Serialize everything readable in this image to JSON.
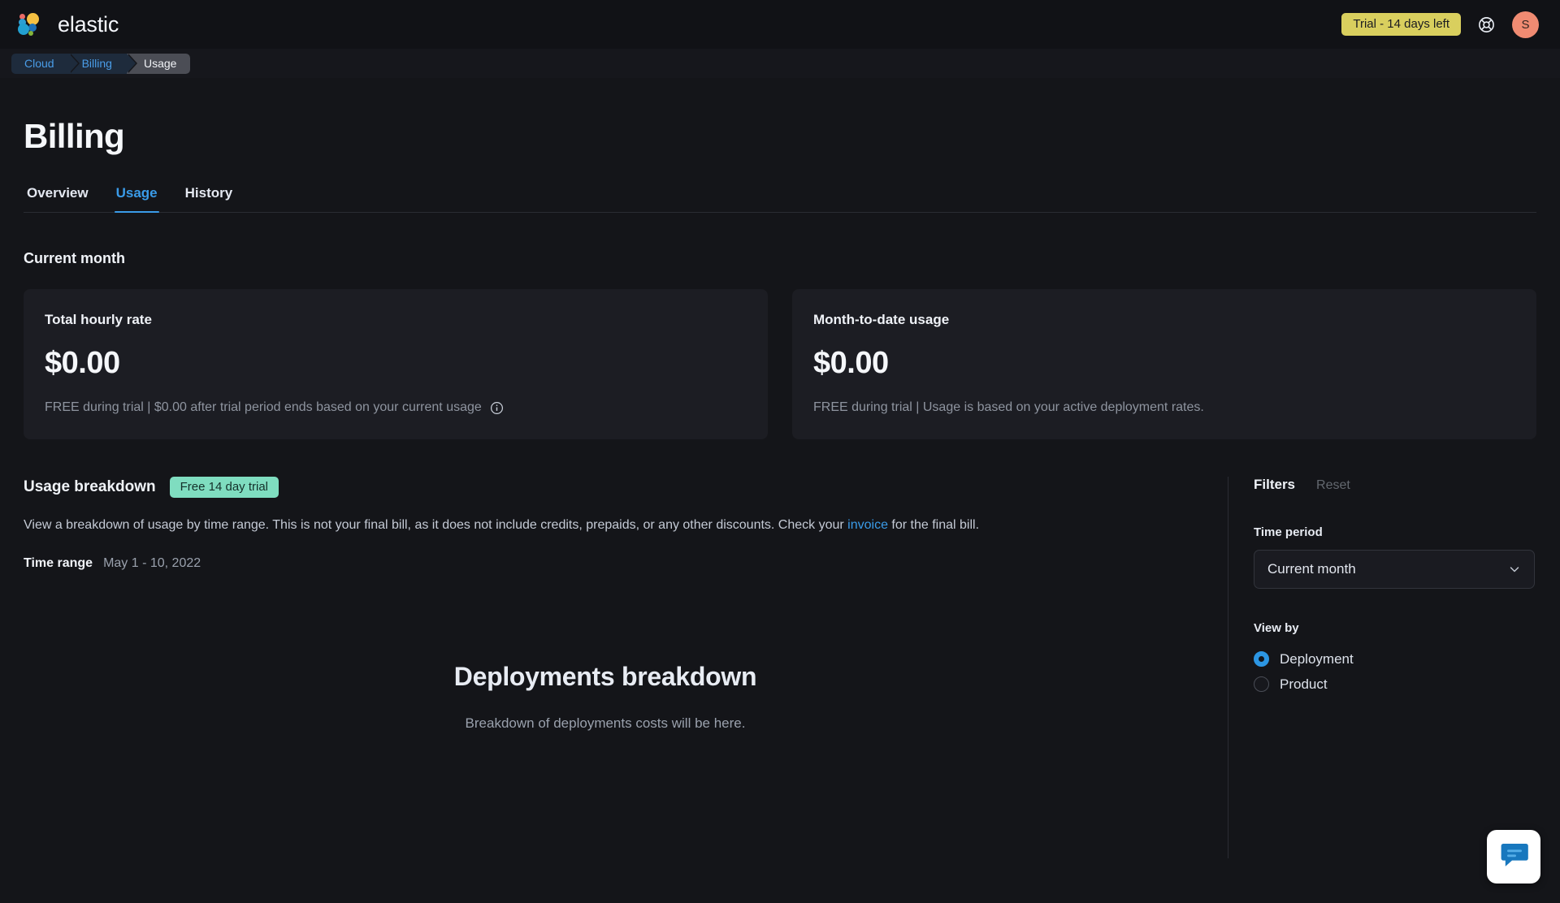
{
  "topbar": {
    "brand_name": "elastic",
    "logo_icon": "elastic-logo",
    "trial_badge": "Trial - 14 days left",
    "help_icon": "lifebuoy-icon",
    "avatar_initial": "S",
    "avatar_color": "#F08B72",
    "trial_badge_color": "#D9CF5E"
  },
  "breadcrumb": {
    "items": [
      {
        "label": "Cloud",
        "current": false
      },
      {
        "label": "Billing",
        "current": false
      },
      {
        "label": "Usage",
        "current": true
      }
    ]
  },
  "page": {
    "title": "Billing",
    "tabs": [
      {
        "label": "Overview",
        "active": false
      },
      {
        "label": "Usage",
        "active": true
      },
      {
        "label": "History",
        "active": false
      }
    ],
    "accent_color": "#3A9BE8"
  },
  "current_month": {
    "heading": "Current month",
    "cards": [
      {
        "title": "Total hourly rate",
        "amount": "$0.00",
        "note": "FREE during trial | $0.00 after trial period ends based on your current usage",
        "info_icon": "info-circle-icon"
      },
      {
        "title": "Month-to-date usage",
        "amount": "$0.00",
        "note": "FREE during trial | Usage is based on your active deployment rates."
      }
    ]
  },
  "usage_breakdown": {
    "title": "Usage breakdown",
    "trial_pill": "Free 14 day trial",
    "trial_pill_color": "#7FDDC0",
    "description_before_link": "View a breakdown of usage by time range. This is not your final bill, as it does not include credits, prepaids, or any other discounts. Check your ",
    "link_text": "invoice",
    "description_after_link": " for the final bill.",
    "time_range_label": "Time range",
    "time_range_value": "May 1 - 10, 2022",
    "empty_state": {
      "title": "Deployments breakdown",
      "subtitle": "Breakdown of deployments costs will be here."
    }
  },
  "filters": {
    "title": "Filters",
    "reset_label": "Reset",
    "time_period": {
      "label": "Time period",
      "selected": "Current month",
      "chevron_icon": "chevron-down-icon"
    },
    "view_by": {
      "label": "View by",
      "options": [
        {
          "label": "Deployment",
          "selected": true
        },
        {
          "label": "Product",
          "selected": false
        }
      ]
    }
  },
  "chat_widget": {
    "icon": "chat-bubble-icon"
  }
}
